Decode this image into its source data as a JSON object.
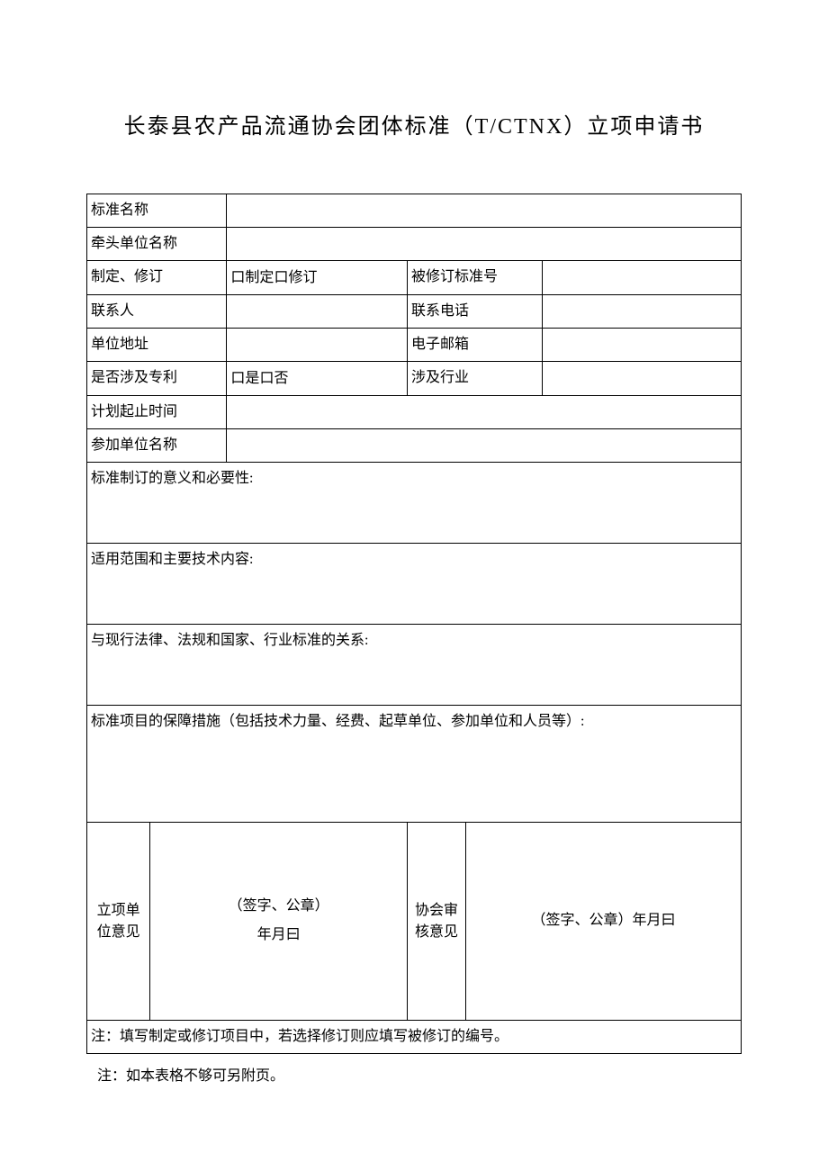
{
  "title": "长泰县农产品流通协会团体标准（T/CTNX）立项申请书",
  "rows": {
    "standardName": {
      "label": "标准名称",
      "value": ""
    },
    "leadUnit": {
      "label": "牵头单位名称",
      "value": ""
    },
    "formulateRevise": {
      "label": "制定、修订",
      "option1": "口制定",
      "option2": "口修订",
      "revisedNoLabel": "被修订标准号",
      "revisedNoValue": ""
    },
    "contact": {
      "label": "联系人",
      "value": "",
      "phoneLabel": "联系电话",
      "phoneValue": ""
    },
    "address": {
      "label": "单位地址",
      "value": "",
      "emailLabel": "电子邮箱",
      "emailValue": ""
    },
    "patent": {
      "label": "是否涉及专利",
      "yes": "口是",
      "no": "口否",
      "industryLabel": "涉及行业",
      "industryValue": ""
    },
    "schedule": {
      "label": "计划起止时间",
      "value": ""
    },
    "participants": {
      "label": "参加单位名称",
      "value": ""
    }
  },
  "sections": {
    "significance": "标准制订的意义和必要性:",
    "scope": "适用范围和主要技术内容:",
    "relation": "与现行法律、法规和国家、行业标准的关系:",
    "measures": "标准项目的保障措施（包括技术力量、经费、起草单位、参加单位和人员等）:"
  },
  "opinions": {
    "unitLabel": "立项单位意见",
    "unitSign": "（签字、公章）",
    "unitDate": "年月曰",
    "assocLabel": "协会审核意见",
    "assocSignDate": "（签字、公章）年月曰"
  },
  "notes": {
    "inTable": "注：填写制定或修订项目中，若选择修订则应填写被修订的编号。",
    "belowTable": "注：如本表格不够可另附页。"
  }
}
